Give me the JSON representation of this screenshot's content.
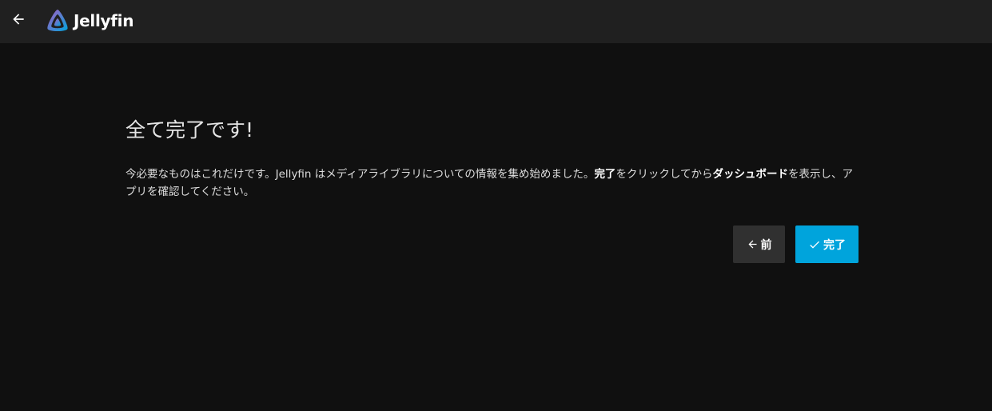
{
  "header": {
    "back_icon": "arrow-left-icon",
    "logo_text": "Jellyfin"
  },
  "main": {
    "title": "全て完了です!",
    "desc_part1": "今必要なものはこれだけです。Jellyfin はメディアライブラリについての情報を集め始めました。",
    "desc_bold1": "完了",
    "desc_part2": "をクリックしてから",
    "desc_bold2": "ダッシュボード",
    "desc_part3": "を表示し、アプリを確認してください。"
  },
  "buttons": {
    "prev_label": "前",
    "prev_icon": "arrow-left-icon",
    "finish_label": "完了",
    "finish_icon": "check-icon"
  },
  "colors": {
    "background": "#101010",
    "header": "#202020",
    "accent": "#00a4dc",
    "secondary_button": "#303030"
  }
}
